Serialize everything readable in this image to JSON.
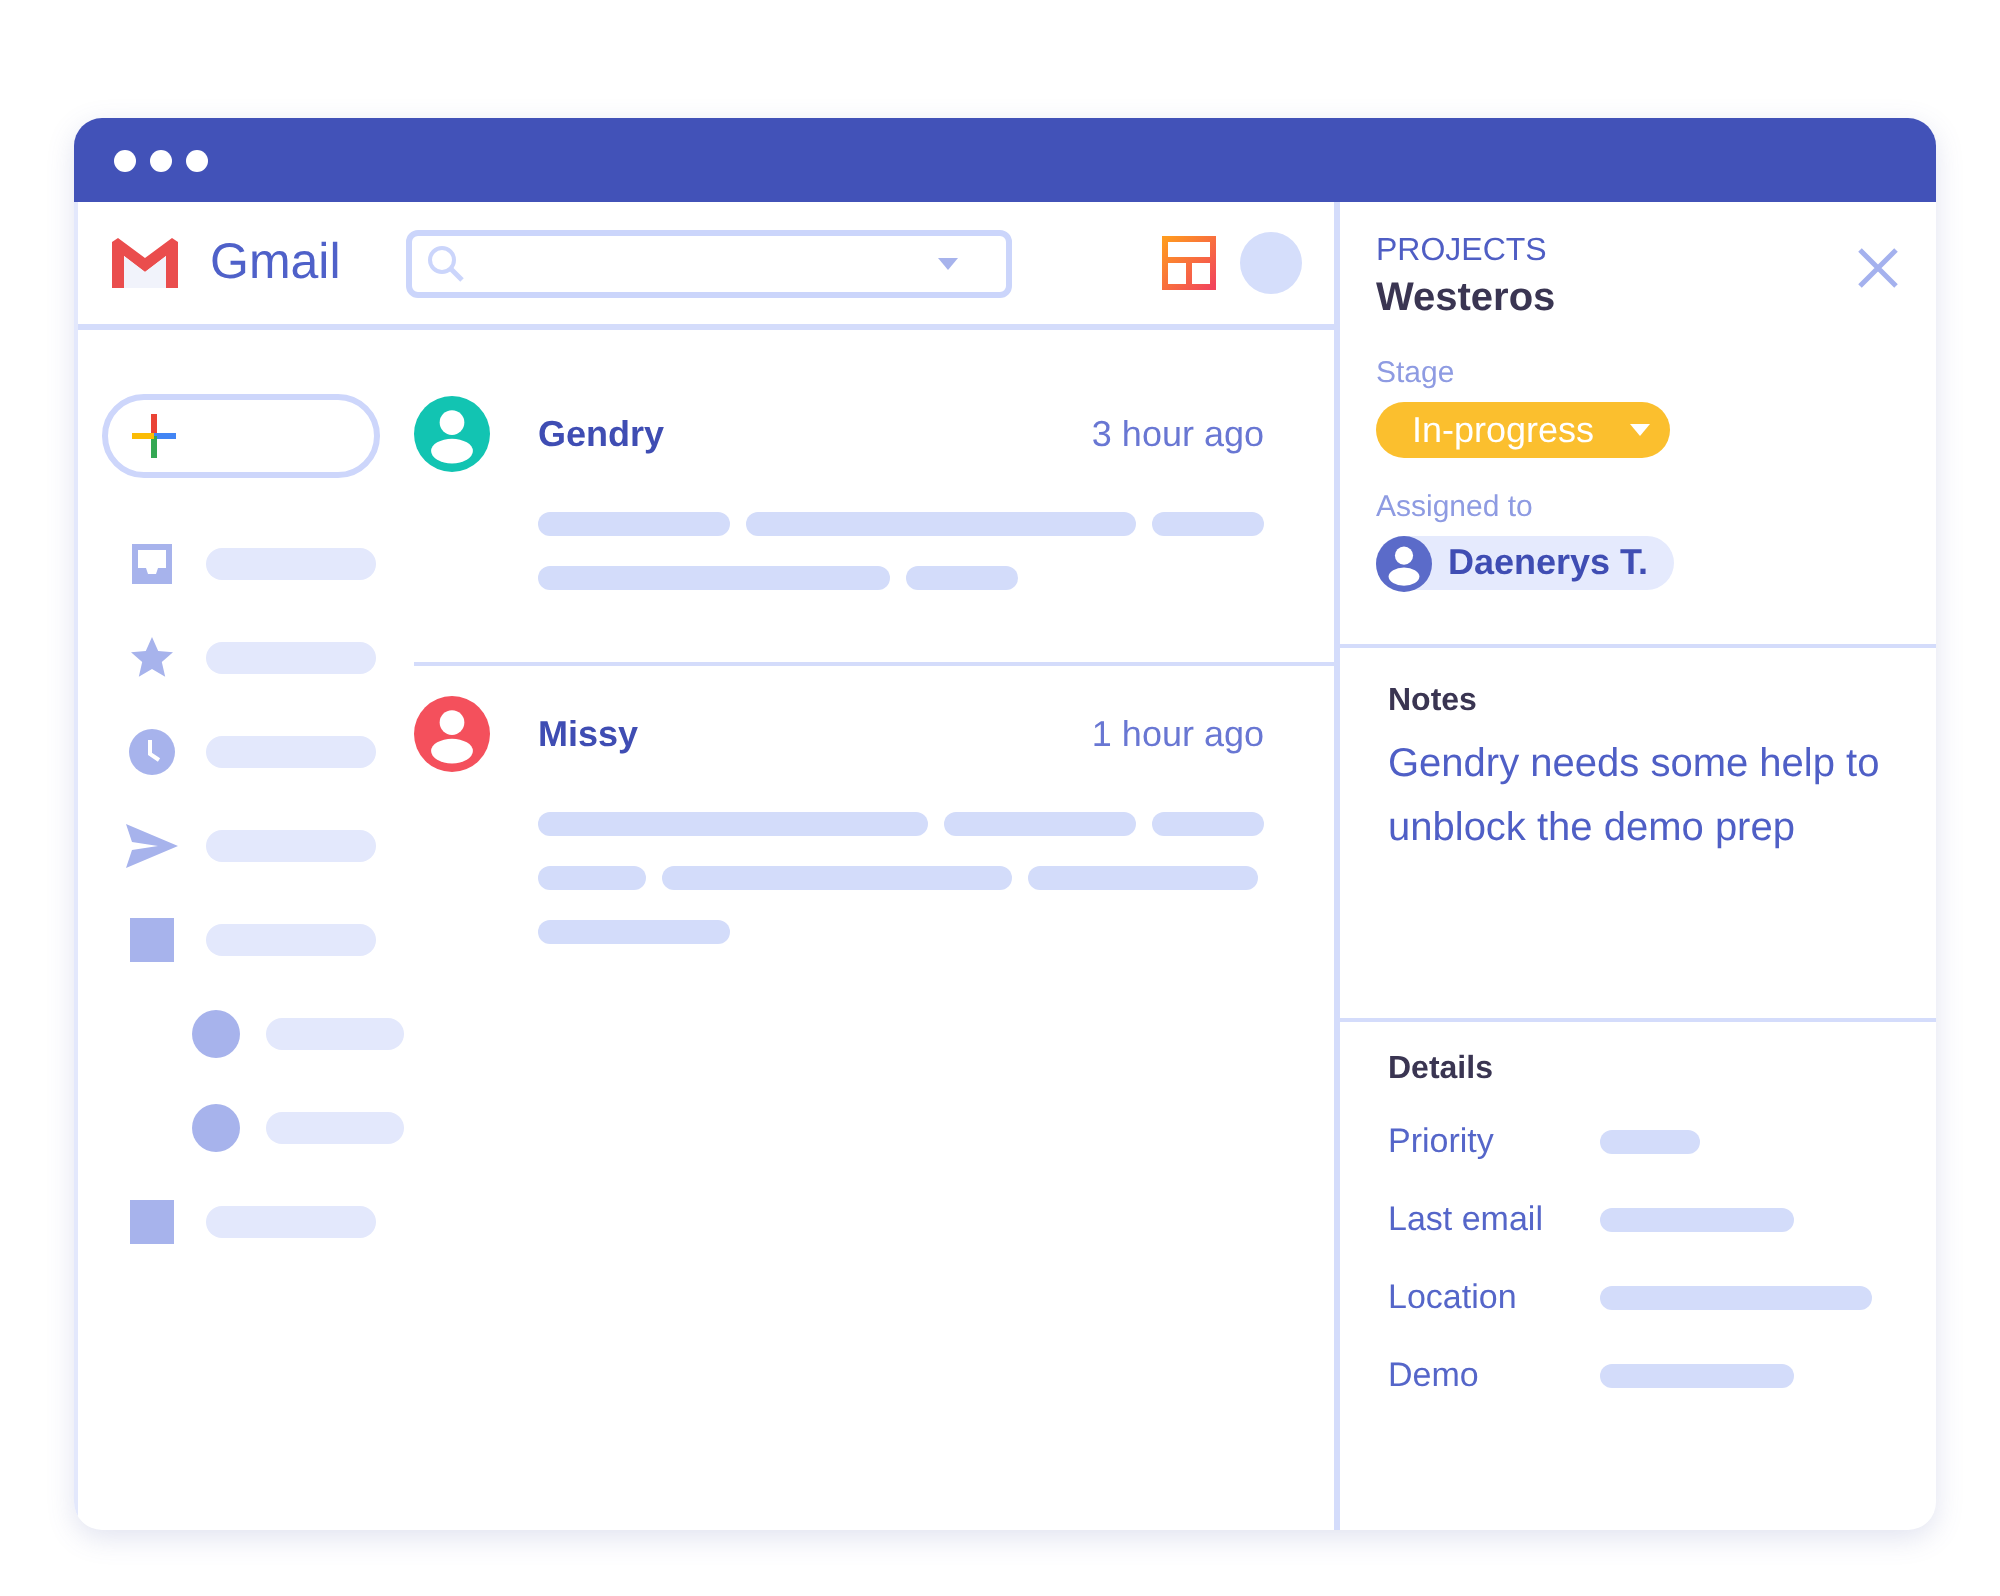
{
  "app": {
    "name": "Gmail"
  },
  "sidebar": {
    "items": [
      {
        "kind": "inbox"
      },
      {
        "kind": "star"
      },
      {
        "kind": "clock"
      },
      {
        "kind": "send"
      },
      {
        "kind": "folder",
        "children": [
          {
            "kind": "dot"
          },
          {
            "kind": "dot"
          }
        ]
      },
      {
        "kind": "folder"
      }
    ]
  },
  "emails": [
    {
      "sender": "Gendry",
      "time": "3 hour ago",
      "color": "#12c4b2"
    },
    {
      "sender": "Missy",
      "time": "1 hour ago",
      "color": "#f4505c"
    }
  ],
  "panel": {
    "section_label": "PROJECTS",
    "title": "Westeros",
    "stage": {
      "label": "Stage",
      "value": "In-progress"
    },
    "assigned": {
      "label": "Assigned to",
      "name": "Daenerys T."
    },
    "notes": {
      "heading": "Notes",
      "text": "Gendry needs some help to unblock the demo prep"
    },
    "details": {
      "heading": "Details",
      "rows": [
        {
          "label": "Priority"
        },
        {
          "label": "Last email"
        },
        {
          "label": "Location"
        },
        {
          "label": "Demo"
        }
      ]
    }
  }
}
